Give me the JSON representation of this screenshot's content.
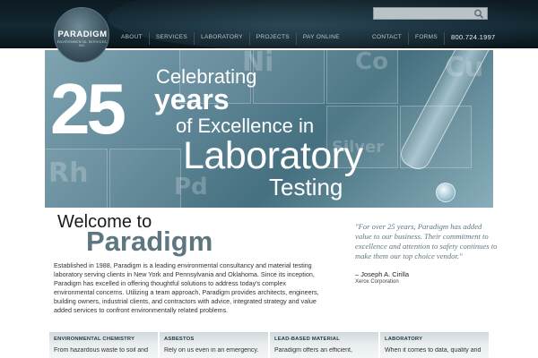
{
  "brand": {
    "name": "PARADIGM",
    "tagline": "ENVIRONMENTAL SERVICES, INC."
  },
  "search": {
    "value": "",
    "placeholder": ""
  },
  "nav": {
    "left": [
      "ABOUT",
      "SERVICES",
      "LABORATORY",
      "PROJECTS",
      "PAY ONLINE"
    ],
    "right": [
      "CONTACT",
      "FORMS"
    ],
    "phone": "800.724.1997"
  },
  "hero": {
    "number": "25",
    "line1": "Celebrating",
    "line2": "years",
    "line3": "of Excellence in",
    "line4": "Laboratory",
    "line5": "Testing"
  },
  "welcome": {
    "heading": "Welcome to",
    "brand": "Paradigm",
    "body": "Established in 1988, Paradigm is a leading environmental consultancy and material testing laboratory serving clients in New York and Pennsylvania and Oklahoma. Since its inception, Paradigm has excelled in offering thoughtful solutions to address today's complex environmental concerns. Utilizing a team approach, Paradigm provides architects, engineers, building owners, industrial clients, and contractors with advice, integrated strategy and value added services to confront environmentally related problems."
  },
  "testimonial": {
    "quote": "\"For over 25 years, Paradigm has added value to our business. Their commitment to excellence and attention to safety continues to make them our top choice vendor.\"",
    "author": "– Joseph A. Cirilla",
    "organization": "Xerox Corporation"
  },
  "services": [
    {
      "title": "ENVIRONMENTAL CHEMISTRY",
      "text": "From hazardous waste to soil and"
    },
    {
      "title": "ASBESTOS",
      "text": "Rely on us even in an emergency."
    },
    {
      "title": "LEAD-BASED MATERIAL",
      "text": "Paradigm offers an efficient,"
    },
    {
      "title": "LABORATORY",
      "text": "When it comes to data, quality and"
    }
  ]
}
